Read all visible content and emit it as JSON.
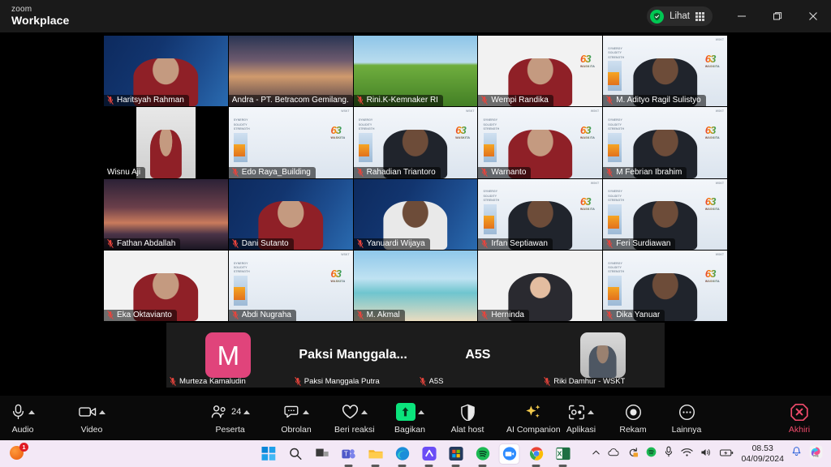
{
  "window": {
    "brand_small": "zoom",
    "brand_main": "Workplace",
    "view_label": "Lihat",
    "view_icon": "grid-icon",
    "security_icon": "shield-check-icon",
    "minimize_icon": "minimize-icon",
    "restore_icon": "restore-icon",
    "close_icon": "close-icon"
  },
  "gallery": {
    "active_speaker": "Andra - PT. Betracom Gemilang...",
    "active_border_color": "#35d07f",
    "tiles": [
      {
        "name": "Haritsyah Rahman",
        "muted": true,
        "bg": "bg-waskita2",
        "person": "red",
        "active": false,
        "logo": false,
        "letterbox": false
      },
      {
        "name": "Andra - PT. Betracom Gemilang...",
        "muted": false,
        "bg": "bg-bridge",
        "person": "",
        "active": true,
        "logo": false,
        "letterbox": false
      },
      {
        "name": "Rini.K-Kemnaker RI",
        "muted": true,
        "bg": "bg-field",
        "person": "",
        "active": false,
        "logo": false,
        "letterbox": false
      },
      {
        "name": "Wempi Randika",
        "muted": true,
        "bg": "bg-plain",
        "person": "red",
        "active": false,
        "logo": true,
        "letterbox": false
      },
      {
        "name": "M. Adityo Ragil Sulistyo",
        "muted": true,
        "bg": "bg-waskita",
        "person": "dark",
        "active": false,
        "logo": true,
        "letterbox": false
      },
      {
        "name": "Wisnu Aji",
        "muted": false,
        "bg": "bg-office",
        "person": "red",
        "active": false,
        "logo": false,
        "letterbox": true
      },
      {
        "name": "Edo Raya_Building",
        "muted": true,
        "bg": "bg-waskita",
        "person": "",
        "active": false,
        "logo": true,
        "letterbox": false
      },
      {
        "name": "Rahadian Triantoro",
        "muted": true,
        "bg": "bg-waskita",
        "person": "dark",
        "active": false,
        "logo": true,
        "letterbox": false
      },
      {
        "name": "Warnanto",
        "muted": true,
        "bg": "bg-waskita",
        "person": "red",
        "active": false,
        "logo": true,
        "letterbox": false
      },
      {
        "name": "M Febrian Ibrahim",
        "muted": true,
        "bg": "bg-waskita",
        "person": "dark",
        "active": false,
        "logo": true,
        "letterbox": false
      },
      {
        "name": "Fathan Abdallah",
        "muted": true,
        "bg": "bg-sunset",
        "person": "",
        "active": false,
        "logo": false,
        "letterbox": false
      },
      {
        "name": "Dani Sutanto",
        "muted": true,
        "bg": "bg-waskita2",
        "person": "red",
        "active": false,
        "logo": false,
        "letterbox": false
      },
      {
        "name": "Yanuardi Wijaya",
        "muted": true,
        "bg": "bg-waskita2",
        "person": "white",
        "active": false,
        "logo": false,
        "letterbox": false
      },
      {
        "name": "Irfan Septiawan",
        "muted": true,
        "bg": "bg-waskita",
        "person": "dark",
        "active": false,
        "logo": true,
        "letterbox": false
      },
      {
        "name": "Feri Surdiawan",
        "muted": true,
        "bg": "bg-waskita",
        "person": "dark",
        "active": false,
        "logo": true,
        "letterbox": false
      },
      {
        "name": "Eka Oktavianto",
        "muted": true,
        "bg": "bg-plain",
        "person": "red",
        "active": false,
        "logo": false,
        "letterbox": false
      },
      {
        "name": "Abdi Nugraha",
        "muted": true,
        "bg": "bg-waskita",
        "person": "",
        "active": false,
        "logo": true,
        "letterbox": false
      },
      {
        "name": "M. Akmal",
        "muted": true,
        "bg": "bg-beach",
        "person": "",
        "active": false,
        "logo": false,
        "letterbox": false
      },
      {
        "name": "Herninda",
        "muted": true,
        "bg": "bg-plain",
        "person": "hijab",
        "active": false,
        "logo": false,
        "letterbox": false
      },
      {
        "name": "Dika Yanuar",
        "muted": true,
        "bg": "bg-waskita",
        "person": "dark",
        "active": false,
        "logo": true,
        "letterbox": false
      }
    ],
    "avatar_row": [
      {
        "name": "Murteza Kamaludin",
        "kind": "initial",
        "initial": "M",
        "color": "#e0447b",
        "muted": true
      },
      {
        "name": "Paksi Manggala Putra",
        "kind": "text",
        "display": "Paksi  Manggala...",
        "muted": true
      },
      {
        "name": "A5S",
        "kind": "text",
        "display": "A5S",
        "muted": true
      },
      {
        "name": "Riki Damhur - WSKT",
        "kind": "photo",
        "muted": true
      }
    ]
  },
  "toolbar": {
    "items": [
      {
        "label": "Audio",
        "icon": "microphone-icon",
        "caret": true,
        "badge": ""
      },
      {
        "label": "Video",
        "icon": "camera-icon",
        "caret": true,
        "badge": ""
      },
      {
        "label": "Peserta",
        "icon": "participants-icon",
        "caret": true,
        "badge": "24"
      },
      {
        "label": "Obrolan",
        "icon": "chat-bubble-icon",
        "caret": true,
        "badge": ""
      },
      {
        "label": "Beri reaksi",
        "icon": "heart-icon",
        "caret": true,
        "badge": ""
      },
      {
        "label": "Bagikan",
        "icon": "share-screen-icon",
        "caret": true,
        "badge": ""
      },
      {
        "label": "Alat host",
        "icon": "shield-icon",
        "caret": false,
        "badge": ""
      },
      {
        "label": "AI Companion",
        "icon": "sparkle-icon",
        "caret": false,
        "badge": ""
      },
      {
        "label": "Aplikasi",
        "icon": "apps-icon",
        "caret": true,
        "badge": ""
      },
      {
        "label": "Rekam",
        "icon": "record-icon",
        "caret": false,
        "badge": ""
      },
      {
        "label": "Lainnya",
        "icon": "ellipsis-icon",
        "caret": false,
        "badge": ""
      }
    ],
    "end_label": "Akhiri",
    "end_icon": "end-call-icon",
    "share_color": "#0be37c",
    "end_color": "#ef4b6b"
  },
  "taskbar": {
    "notification_badge": "1",
    "notification_icon": "ubuntu-icon",
    "items": [
      {
        "name": "start-button",
        "icon": "windows-icon"
      },
      {
        "name": "search-button",
        "icon": "search-icon"
      },
      {
        "name": "task-view-button",
        "icon": "task-view-icon"
      },
      {
        "name": "teams",
        "icon": "teams-icon"
      },
      {
        "name": "file-explorer",
        "icon": "folder-icon"
      },
      {
        "name": "edge",
        "icon": "edge-icon"
      },
      {
        "name": "monday",
        "icon": "monday-icon"
      },
      {
        "name": "microsoft-store",
        "icon": "store-icon"
      },
      {
        "name": "spotify",
        "icon": "spotify-icon"
      },
      {
        "name": "zoom",
        "icon": "zoom-icon"
      },
      {
        "name": "chrome",
        "icon": "chrome-icon"
      },
      {
        "name": "excel",
        "icon": "excel-icon"
      }
    ],
    "tray": {
      "overflow_icon": "chevron-up-icon",
      "onedrive_icon": "cloud-icon",
      "update_icon": "sync-icon",
      "spotify_icon": "spotify-tray-icon",
      "mic_icon": "microphone-tray-icon",
      "wifi_icon": "wifi-icon",
      "volume_icon": "speaker-icon",
      "battery_icon": "battery-charging-icon",
      "time": "08.53",
      "date": "04/09/2024",
      "bell_icon": "bell-icon",
      "copilot_icon": "copilot-icon"
    }
  }
}
